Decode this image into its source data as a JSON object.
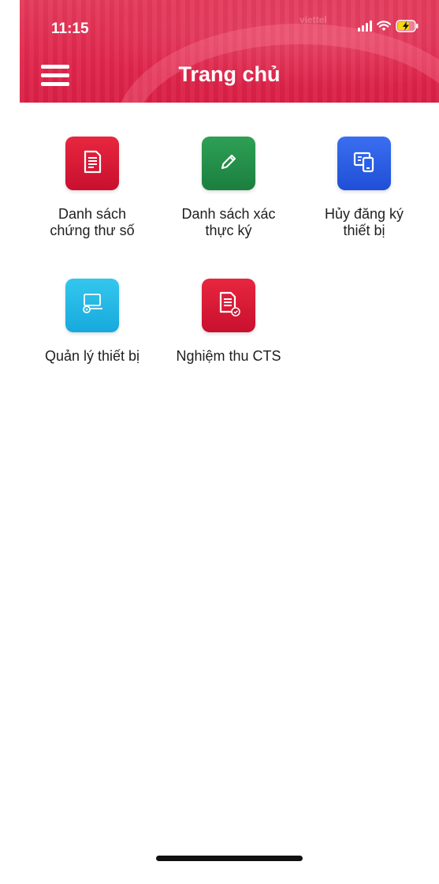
{
  "status_bar": {
    "time": "11:15",
    "brand": "viettel"
  },
  "header": {
    "title": "Trang chủ"
  },
  "tiles": [
    {
      "label_line1": "Danh sách",
      "label_line2": "chứng thư số",
      "icon": "document-icon",
      "color": "#d81d3b"
    },
    {
      "label_line1": "Danh sách xác",
      "label_line2": "thực ký",
      "icon": "pencil-icon",
      "color": "#22914a"
    },
    {
      "label_line1": "Hủy đăng ký",
      "label_line2": "thiết bị",
      "icon": "devices-icon",
      "color": "#2a5fe6"
    },
    {
      "label_line1": "Quản lý thiết bị",
      "label_line2": "",
      "icon": "device-settings-icon",
      "color": "#22b8e6"
    },
    {
      "label_line1": "Nghiệm thu CTS",
      "label_line2": "",
      "icon": "document-check-icon",
      "color": "#d81d3b"
    }
  ]
}
